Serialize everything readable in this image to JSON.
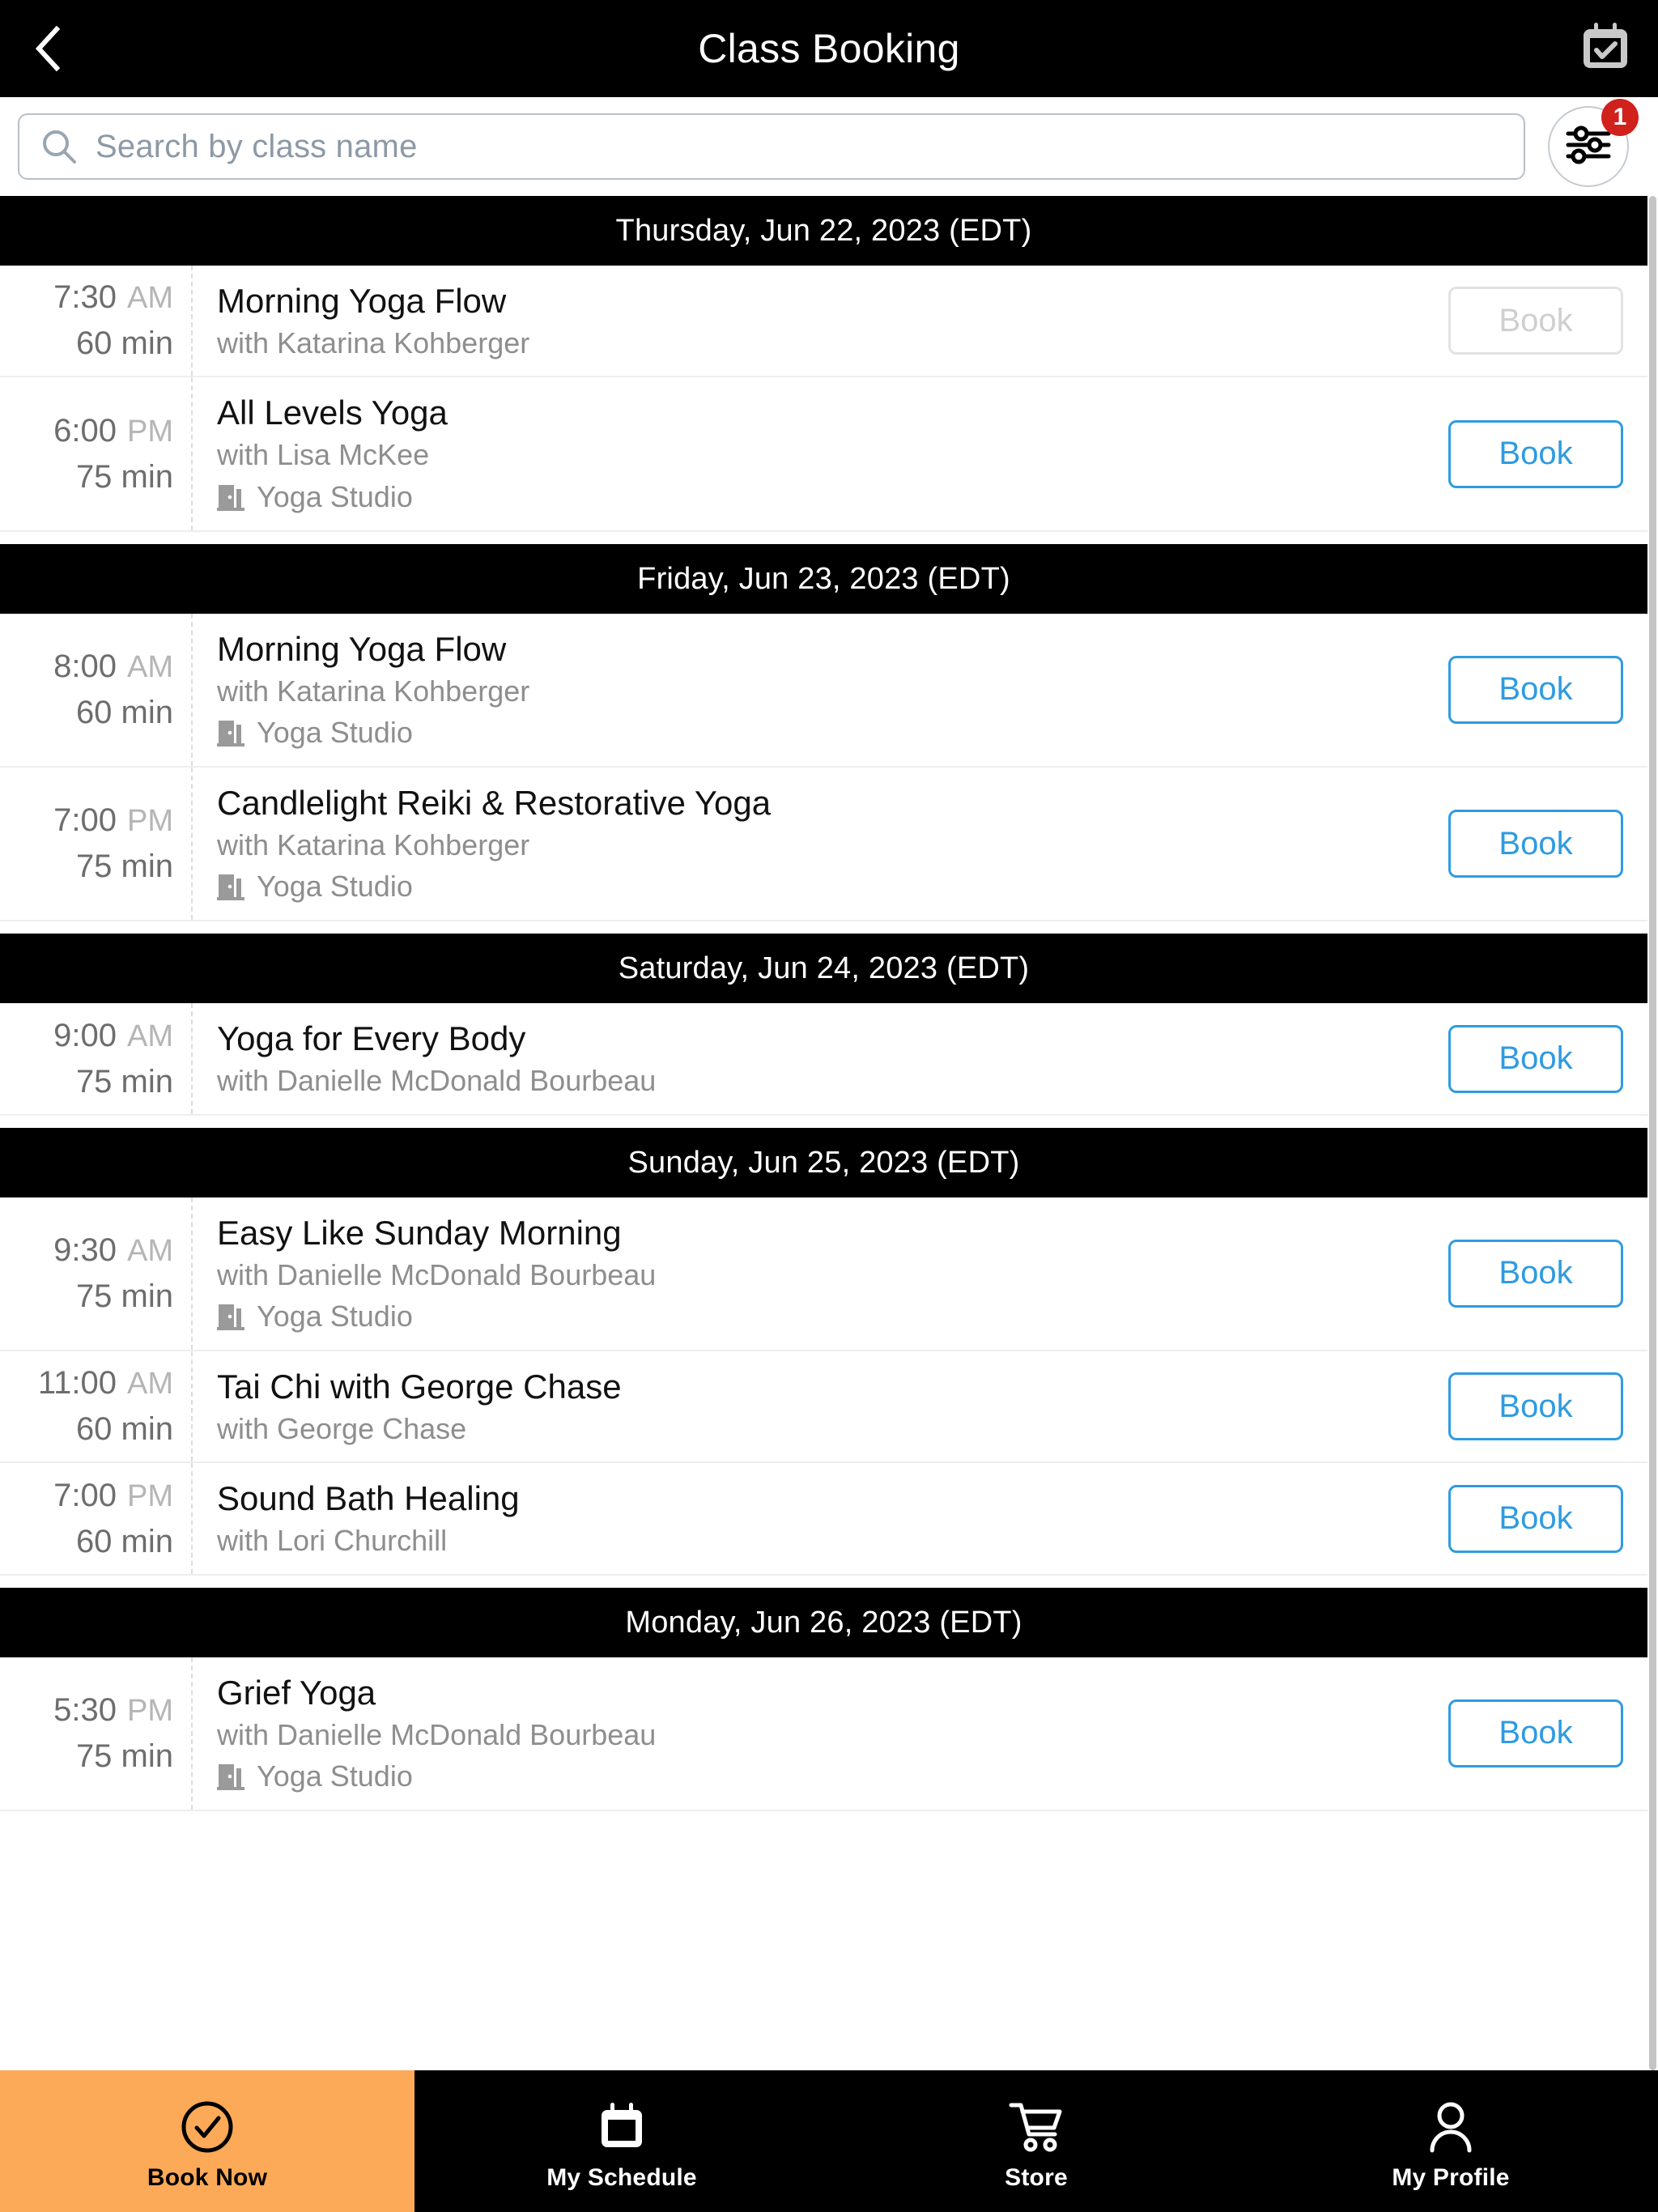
{
  "header": {
    "title": "Class Booking",
    "back_icon": "chevron-left-icon",
    "calendar_check_icon": "calendar-check-icon"
  },
  "search": {
    "placeholder": "Search by class name",
    "value": "",
    "search_icon": "search-icon",
    "filter_icon": "sliders-filter-icon",
    "filter_badge": "1",
    "badge_color": "#d0211c"
  },
  "theme": {
    "accent_blue": "#2f9be0",
    "active_nav_orange": "#fcaa57",
    "header_black": "#000000",
    "disabled_grey": "#cfcfcf"
  },
  "days": [
    {
      "header": "Thursday, Jun 22, 2023 (EDT)",
      "classes": [
        {
          "time": "7:30",
          "meridiem": "AM",
          "duration": "60 min",
          "name": "Morning Yoga Flow",
          "teacher": "with Katarina Kohberger",
          "location": "",
          "button": "Book",
          "disabled": true
        },
        {
          "time": "6:00",
          "meridiem": "PM",
          "duration": "75 min",
          "name": "All Levels Yoga",
          "teacher": "with Lisa McKee",
          "location": "Yoga Studio",
          "button": "Book",
          "disabled": false
        }
      ]
    },
    {
      "header": "Friday, Jun 23, 2023 (EDT)",
      "classes": [
        {
          "time": "8:00",
          "meridiem": "AM",
          "duration": "60 min",
          "name": "Morning Yoga Flow",
          "teacher": "with Katarina Kohberger",
          "location": "Yoga Studio",
          "button": "Book",
          "disabled": false
        },
        {
          "time": "7:00",
          "meridiem": "PM",
          "duration": "75 min",
          "name": "Candlelight Reiki & Restorative Yoga",
          "teacher": "with Katarina Kohberger",
          "location": "Yoga Studio",
          "button": "Book",
          "disabled": false
        }
      ]
    },
    {
      "header": "Saturday, Jun 24, 2023 (EDT)",
      "classes": [
        {
          "time": "9:00",
          "meridiem": "AM",
          "duration": "75 min",
          "name": "Yoga for Every Body",
          "teacher": "with Danielle McDonald Bourbeau",
          "location": "",
          "button": "Book",
          "disabled": false
        }
      ]
    },
    {
      "header": "Sunday, Jun 25, 2023 (EDT)",
      "classes": [
        {
          "time": "9:30",
          "meridiem": "AM",
          "duration": "75 min",
          "name": "Easy Like Sunday Morning",
          "teacher": "with Danielle McDonald Bourbeau",
          "location": "Yoga Studio",
          "button": "Book",
          "disabled": false
        },
        {
          "time": "11:00",
          "meridiem": "AM",
          "duration": "60 min",
          "name": "Tai Chi with George Chase",
          "teacher": "with George Chase",
          "location": "",
          "button": "Book",
          "disabled": false
        },
        {
          "time": "7:00",
          "meridiem": "PM",
          "duration": "60 min",
          "name": "Sound Bath Healing",
          "teacher": "with Lori Churchill",
          "location": "",
          "button": "Book",
          "disabled": false
        }
      ]
    },
    {
      "header": "Monday, Jun 26, 2023 (EDT)",
      "classes": [
        {
          "time": "5:30",
          "meridiem": "PM",
          "duration": "75 min",
          "name": "Grief Yoga",
          "teacher": "with Danielle McDonald Bourbeau",
          "location": "Yoga Studio",
          "button": "Book",
          "disabled": false
        }
      ]
    }
  ],
  "bottom_nav": [
    {
      "label": "Book Now",
      "icon": "check-circle-icon",
      "active": true
    },
    {
      "label": "My Schedule",
      "icon": "calendar-icon",
      "active": false
    },
    {
      "label": "Store",
      "icon": "shopping-cart-icon",
      "active": false
    },
    {
      "label": "My Profile",
      "icon": "person-icon",
      "active": false
    }
  ]
}
